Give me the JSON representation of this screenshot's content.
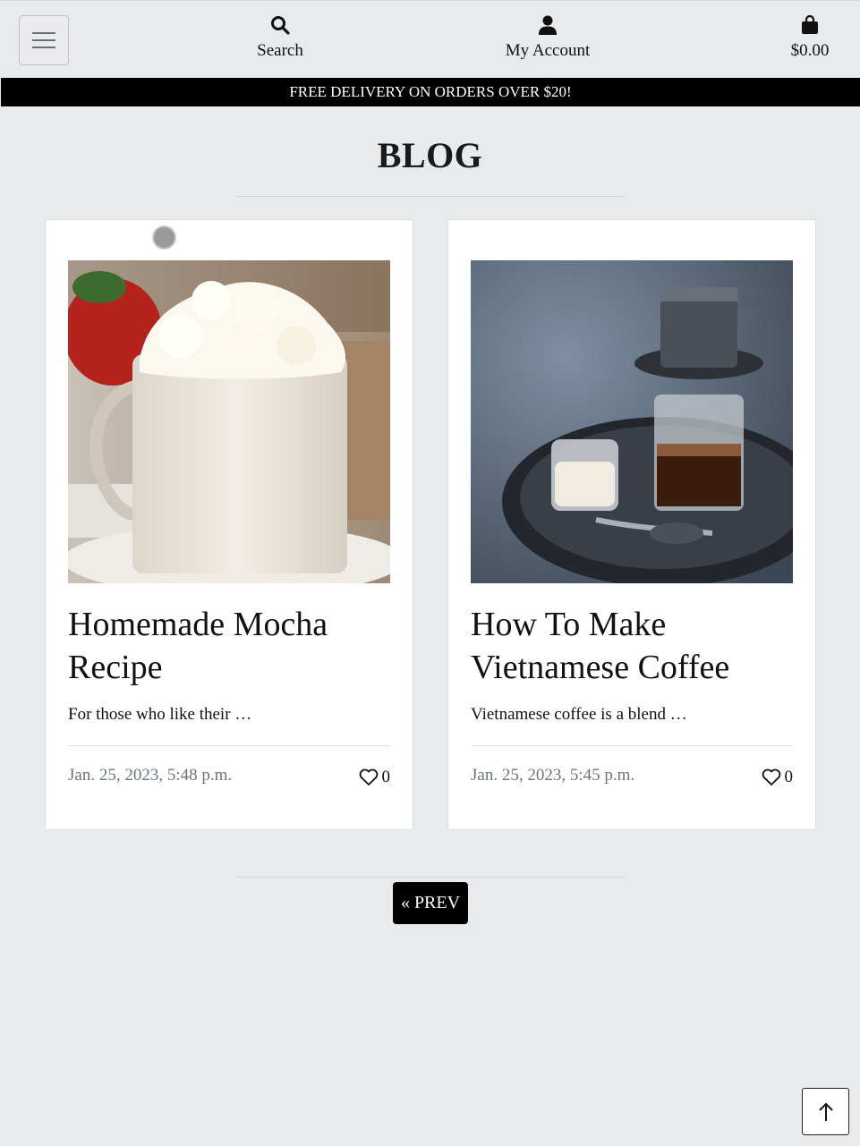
{
  "header": {
    "search_label": "Search",
    "account_label": "My Account",
    "cart_total": "$0.00"
  },
  "banner": {
    "text": "FREE DELIVERY ON ORDERS OVER $20!"
  },
  "page": {
    "title": "BLOG"
  },
  "posts": [
    {
      "title": "Homemade Mocha Recipe",
      "excerpt": "For those who like their …",
      "date": "Jan. 25, 2023, 5:48 p.m.",
      "likes": "0"
    },
    {
      "title": "How To Make Vietnamese Coffee",
      "excerpt": "Vietnamese coffee is a blend …",
      "date": "Jan. 25, 2023, 5:45 p.m.",
      "likes": "0"
    }
  ],
  "pagination": {
    "prev_label": "« PREV"
  },
  "colors": {
    "background": "#e9eaec",
    "banner": "#000000",
    "muted_text": "#6c757d"
  },
  "icons": [
    "hamburger-icon",
    "search-icon",
    "user-icon",
    "shopping-bag-icon",
    "heart-icon",
    "arrow-up-icon"
  ]
}
